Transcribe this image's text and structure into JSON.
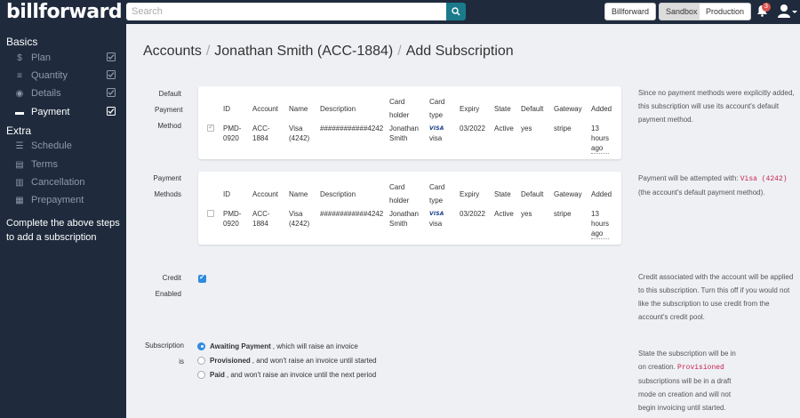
{
  "brand": "billforward",
  "topbar": {
    "search_placeholder": "Search",
    "billforward_label": "Billforward",
    "sandbox_label": "Sandbox",
    "production_label": "Production",
    "notification_count": "3"
  },
  "sidebar": {
    "basics_header": "Basics",
    "extra_header": "Extra",
    "basics_items": [
      {
        "icon": "$",
        "label": "Plan"
      },
      {
        "icon": "≡",
        "label": "Quantity"
      },
      {
        "icon": "◉",
        "label": "Details"
      },
      {
        "icon": "▬",
        "label": "Payment"
      }
    ],
    "extra_items": [
      {
        "icon": "☰",
        "label": "Schedule"
      },
      {
        "icon": "▤",
        "label": "Terms"
      },
      {
        "icon": "▥",
        "label": "Cancellation"
      },
      {
        "icon": "▦",
        "label": "Prepayment"
      }
    ],
    "note": "Complete the above steps to add a subscription"
  },
  "breadcrumb": {
    "accounts": "Accounts",
    "customer": "Jonathan Smith (ACC-1884)",
    "current": "Add Subscription",
    "separator": "/"
  },
  "default_payment": {
    "label_line1": "Default",
    "label_line2": "Payment",
    "label_line3": "Method",
    "headers": {
      "id": "ID",
      "account": "Account",
      "name": "Name",
      "description": "Description",
      "card_holder_1": "Card",
      "card_holder_2": "holder",
      "card_type_1": "Card",
      "card_type_2": "type",
      "expiry": "Expiry",
      "state": "State",
      "default": "Default",
      "gateway": "Gateway",
      "added": "Added"
    },
    "row": {
      "id_1": "PMD-",
      "id_2": "0920",
      "account_1": "ACC-",
      "account_2": "1884",
      "name_1": "Visa",
      "name_2": "(4242)",
      "description": "############4242",
      "holder_1": "Jonathan",
      "holder_2": "Smith",
      "card_logo": "VISA",
      "card_type": "visa",
      "expiry": "03/2022",
      "state": "Active",
      "default": "yes",
      "gateway": "stripe",
      "added_1": "13",
      "added_2": "hours",
      "added_3": "ago"
    },
    "help": [
      "Since no payment methods were explicitly added,",
      "this subscription will use its account's default",
      "payment method."
    ]
  },
  "payment_methods": {
    "label_line1": "Payment",
    "label_line2": "Methods",
    "headers": {
      "id": "ID",
      "account": "Account",
      "name": "Name",
      "description": "Description",
      "card_holder_1": "Card",
      "card_holder_2": "holder",
      "card_type_1": "Card",
      "card_type_2": "type",
      "expiry": "Expiry",
      "state": "State",
      "default": "Default",
      "gateway": "Gateway",
      "added": "Added"
    },
    "row": {
      "id_1": "PMD-",
      "id_2": "0920",
      "account_1": "ACC-",
      "account_2": "1884",
      "name_1": "Visa",
      "name_2": "(4242)",
      "description": "############4242",
      "holder_1": "Jonathan",
      "holder_2": "Smith",
      "card_logo": "VISA",
      "card_type": "visa",
      "expiry": "03/2022",
      "state": "Active",
      "default": "yes",
      "gateway": "stripe",
      "added_1": "13",
      "added_2": "hours",
      "added_3": "ago"
    },
    "help_prefix": "Payment will be attempted with:",
    "help_code": "Visa (4242)",
    "help_suffix": "(the account's default payment method)."
  },
  "credit": {
    "label_line1": "Credit",
    "label_line2": "Enabled",
    "checked": true,
    "help": [
      "Credit associated with the account will be applied",
      "to this subscription. Turn this off if you would not",
      "like the subscription to use credit from the",
      "account's credit pool."
    ]
  },
  "subscription_is": {
    "label_line1": "Subscription",
    "label_line2": "is",
    "options": [
      {
        "bold": "Awaiting Payment",
        "rest": ", which will raise an invoice",
        "selected": true
      },
      {
        "bold": "Provisioned",
        "rest": ", and won't raise an invoice until started",
        "selected": false
      },
      {
        "bold": "Paid",
        "rest": ", and won't raise an invoice until the next period",
        "selected": false
      }
    ],
    "help_line1": "State the subscription will be in",
    "help_line2_prefix": "on creation.",
    "help_code": "Provisioned",
    "help_line3": "subscriptions will be in a draft",
    "help_line4": "mode on creation and will not",
    "help_line5": "begin invoicing until started."
  },
  "colors": {
    "nav_bg": "#1f2b3d",
    "accent": "#2f8ae0",
    "search_btn": "#1b7a8c",
    "code": "#c7254e"
  }
}
